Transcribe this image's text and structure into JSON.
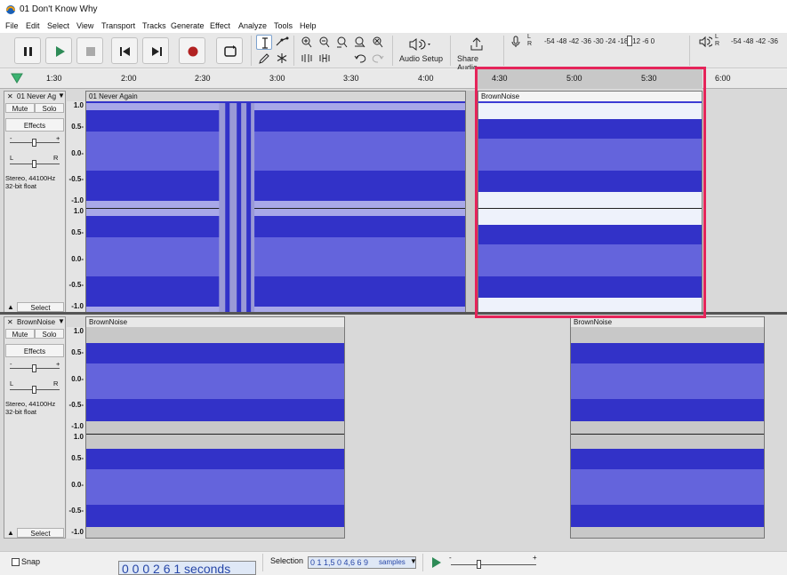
{
  "window": {
    "title": "01 Don't Know Why"
  },
  "menu": [
    "File",
    "Edit",
    "Select",
    "View",
    "Transport",
    "Tracks",
    "Generate",
    "Effect",
    "Analyze",
    "Tools",
    "Help"
  ],
  "toolbar": {
    "audio_setup_label": "Audio Setup",
    "share_audio_label": "Share Audio",
    "record_meter_ticks": "-54 -48 -42 -36 -30 -24 -18 -12 -6 0",
    "play_meter_ticks": "-54 -48 -42 -36",
    "record_meter_lr": "L\nR",
    "play_meter_lr": "L\nR"
  },
  "ruler": {
    "ticks": [
      "1:30",
      "2:00",
      "2:30",
      "3:00",
      "3:30",
      "4:00",
      "4:30",
      "5:00",
      "5:30",
      "6:00"
    ]
  },
  "tracks": [
    {
      "name": "01 Never Ag",
      "clip_names": [
        "01 Never Again",
        "BrownNoise"
      ],
      "mute": "Mute",
      "solo": "Solo",
      "effects": "Effects",
      "gain_minus": "-",
      "gain_plus": "+",
      "pan_l": "L",
      "pan_r": "R",
      "info_line1": "Stereo, 44100Hz",
      "info_line2": "32-bit float",
      "select": "Select"
    },
    {
      "name": "BrownNoise",
      "clip_names": [
        "BrownNoise",
        "BrownNoise"
      ],
      "mute": "Mute",
      "solo": "Solo",
      "effects": "Effects",
      "gain_minus": "-",
      "gain_plus": "+",
      "pan_l": "L",
      "pan_r": "R",
      "info_line1": "Stereo, 44100Hz",
      "info_line2": "32-bit float",
      "select": "Select"
    }
  ],
  "vscale_labels": [
    "1.0",
    "0.5-",
    "0.0-",
    "-0.5-",
    "-1.0"
  ],
  "bottom": {
    "snap_label": "Snap",
    "time_display": "0 0 0 2 6 1 seconds",
    "selection_label": "Selection",
    "selection_value": "0 1 1,5 0 4,6 6 9",
    "selection_unit": "samples",
    "play_speed_minus": "-",
    "play_speed_plus": "+"
  },
  "colors": {
    "waveform": "#3232c8",
    "waveform_rms": "#6464dc",
    "clip_header": "#e8e8e8",
    "highlight": "#e5245a"
  }
}
